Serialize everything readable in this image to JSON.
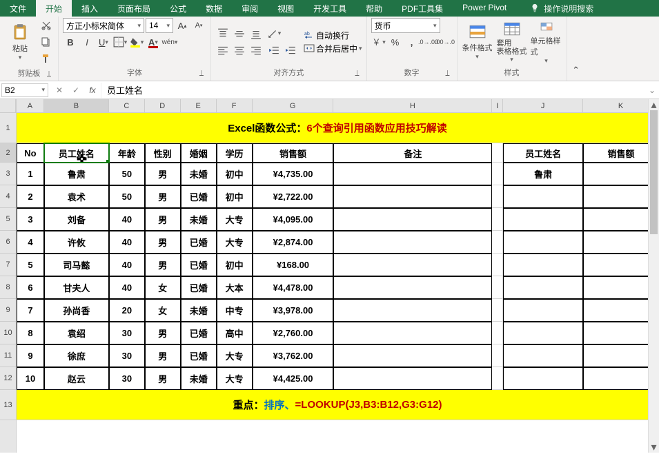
{
  "tabs": [
    "文件",
    "开始",
    "插入",
    "页面布局",
    "公式",
    "数据",
    "审阅",
    "视图",
    "开发工具",
    "帮助",
    "PDF工具集",
    "Power Pivot"
  ],
  "active_tab_index": 1,
  "search_prompt": "操作说明搜索",
  "clipboard": {
    "paste": "粘贴",
    "label": "剪贴板"
  },
  "font": {
    "name": "方正小标宋简体",
    "size": "14",
    "label": "字体"
  },
  "align": {
    "wrap": "自动换行",
    "merge": "合并后居中",
    "label": "对齐方式"
  },
  "number": {
    "format": "货币",
    "label": "数字"
  },
  "styles": {
    "cond": "条件格式",
    "table": "套用\n表格格式",
    "cell": "单元格样式",
    "label": "样式"
  },
  "namebox": "B2",
  "formula": "员工姓名",
  "columns": [
    "A",
    "B",
    "C",
    "D",
    "E",
    "F",
    "G",
    "H",
    "I",
    "J",
    "K"
  ],
  "title_black": "Excel函数公式：",
  "title_red": "6个查询引用函数应用技巧解读",
  "headers": {
    "no": "No",
    "name": "员工姓名",
    "age": "年龄",
    "gender": "性别",
    "marriage": "婚姻",
    "edu": "学历",
    "sales": "销售额",
    "note": "备注",
    "jname": "员工姓名",
    "ksales": "销售额"
  },
  "rows": [
    {
      "no": "1",
      "name": "鲁肃",
      "age": "50",
      "gender": "男",
      "marriage": "未婚",
      "edu": "初中",
      "sales": "¥4,735.00"
    },
    {
      "no": "2",
      "name": "袁术",
      "age": "50",
      "gender": "男",
      "marriage": "已婚",
      "edu": "初中",
      "sales": "¥2,722.00"
    },
    {
      "no": "3",
      "name": "刘备",
      "age": "40",
      "gender": "男",
      "marriage": "未婚",
      "edu": "大专",
      "sales": "¥4,095.00"
    },
    {
      "no": "4",
      "name": "许攸",
      "age": "40",
      "gender": "男",
      "marriage": "已婚",
      "edu": "大专",
      "sales": "¥2,874.00"
    },
    {
      "no": "5",
      "name": "司马懿",
      "age": "40",
      "gender": "男",
      "marriage": "已婚",
      "edu": "初中",
      "sales": "¥168.00"
    },
    {
      "no": "6",
      "name": "甘夫人",
      "age": "40",
      "gender": "女",
      "marriage": "已婚",
      "edu": "大本",
      "sales": "¥4,478.00"
    },
    {
      "no": "7",
      "name": "孙尚香",
      "age": "20",
      "gender": "女",
      "marriage": "未婚",
      "edu": "中专",
      "sales": "¥3,978.00"
    },
    {
      "no": "8",
      "name": "袁绍",
      "age": "30",
      "gender": "男",
      "marriage": "已婚",
      "edu": "高中",
      "sales": "¥2,760.00"
    },
    {
      "no": "9",
      "name": "徐庶",
      "age": "30",
      "gender": "男",
      "marriage": "已婚",
      "edu": "大专",
      "sales": "¥3,762.00"
    },
    {
      "no": "10",
      "name": "赵云",
      "age": "30",
      "gender": "男",
      "marriage": "未婚",
      "edu": "大专",
      "sales": "¥4,425.00"
    }
  ],
  "lookup_name": "鲁肃",
  "footer_black": "重点：",
  "footer_blue": "排序、",
  "footer_red": "=LOOKUP(J3,B3:B12,G3:G12)"
}
